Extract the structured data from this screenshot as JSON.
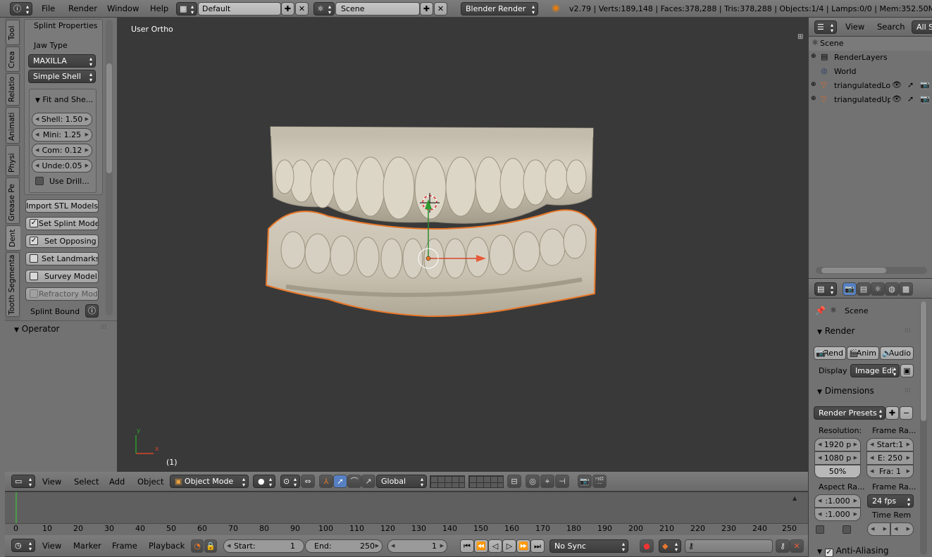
{
  "top_bar": {
    "menus": [
      "File",
      "Render",
      "Window",
      "Help"
    ],
    "screen_layout": "Default",
    "scene": "Scene",
    "render_engine": "Blender Render",
    "stats": "v2.79 | Verts:189,148 | Faces:378,288 | Tris:378,288 | Objects:1/4 | Lamps:0/0 | Mem:352.50M"
  },
  "tool_tabs": [
    "Tool",
    "Crea",
    "Relatio",
    "Animati",
    "Physi",
    "Grease Pe",
    "Dent",
    "Tooth Segmenta"
  ],
  "left_panel": {
    "title": "Splint Properties",
    "jaw_type_label": "Jaw Type",
    "jaw_type_value": "MAXILLA",
    "shell_type": "Simple Shell",
    "fit_panel_title": "Fit and She...",
    "fields": [
      "Shell: 1.50",
      "Mini:  1.25",
      "Com: 0.12",
      "Unde:0.05"
    ],
    "use_drill_label": "Use Drill...",
    "import_button": "Import STL Models",
    "set_splint_model": "Set Splint Model",
    "set_opposing": "Set Opposing",
    "set_landmarks": "Set Landmarks",
    "survey_model": "Survey Model",
    "refractory_model": "Refractory Model",
    "splint_bound": "Splint Bound",
    "operator_title": "Operator"
  },
  "viewport": {
    "view_label": "User Ortho",
    "frame_label": "(1)",
    "axis_x": "x",
    "axis_y": "y",
    "colors": {
      "background": "#393939",
      "selection_outline": "#e8772a"
    }
  },
  "viewport_header": {
    "menus": [
      "View",
      "Select",
      "Add",
      "Object"
    ],
    "mode": "Object Mode",
    "orientation": "Global"
  },
  "timeline": {
    "ticks": [
      "0",
      "10",
      "20",
      "30",
      "40",
      "50",
      "60",
      "70",
      "80",
      "90",
      "100",
      "110",
      "120",
      "130",
      "140",
      "150",
      "160",
      "170",
      "180",
      "190",
      "200",
      "210",
      "220",
      "230",
      "240",
      "250"
    ],
    "menus": [
      "View",
      "Marker",
      "Frame",
      "Playback"
    ],
    "start_label": "Start:",
    "start_value": "1",
    "end_label": "End:",
    "end_value": "250",
    "current_frame": "1",
    "sync": "No Sync"
  },
  "outliner": {
    "menus": [
      "View",
      "Search"
    ],
    "filter": "All S",
    "items": [
      {
        "label": "Scene",
        "icon": "scene-icon",
        "indent": 0
      },
      {
        "label": "RenderLayers",
        "icon": "render-layers-icon",
        "indent": 1
      },
      {
        "label": "World",
        "icon": "world-icon",
        "indent": 1
      },
      {
        "label": "triangulatedLov",
        "icon": "mesh-icon",
        "indent": 1
      },
      {
        "label": "triangulatedUpp",
        "icon": "mesh-icon",
        "indent": 1
      }
    ]
  },
  "properties": {
    "scene_label": "Scene",
    "render_title": "Render",
    "render_buttons": [
      "Rend",
      "Anim",
      "Audio"
    ],
    "display_label": "Display",
    "display_value": "Image Edi",
    "dimensions_title": "Dimensions",
    "render_presets": "Render Presets",
    "resolution_label": "Resolution:",
    "frame_range_label": "Frame Ra...",
    "res_x": "1920 p",
    "res_y": "1080 p",
    "res_pct": "50%",
    "start_frame": "Start:1",
    "end_frame": "E: 250",
    "frame_step": "Fra:  1",
    "aspect_label": "Aspect Ra...",
    "frame_rate_label": "Frame Ra...",
    "aspect_x": ":1.000",
    "aspect_y": ":1.000",
    "fps": "24 fps",
    "time_remap_label": "Time Rem",
    "anti_aliasing": "Anti-Aliasing"
  }
}
